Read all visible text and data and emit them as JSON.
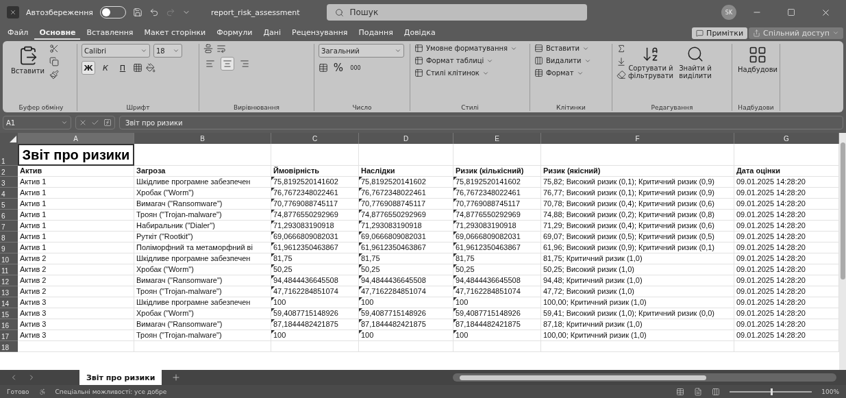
{
  "title_bar": {
    "autosave_label": "Автозбереження",
    "autosave_on": false,
    "file_name": "report_risk_assessment",
    "search": {
      "placeholder": "Пошук"
    },
    "avatar": "SK"
  },
  "menu_tabs": [
    {
      "label": "Файл",
      "selected": false
    },
    {
      "label": "Основне",
      "selected": true
    },
    {
      "label": "Вставлення",
      "selected": false
    },
    {
      "label": "Макет сторінки",
      "selected": false
    },
    {
      "label": "Формули",
      "selected": false
    },
    {
      "label": "Дані",
      "selected": false
    },
    {
      "label": "Рецензування",
      "selected": false
    },
    {
      "label": "Подання",
      "selected": false
    },
    {
      "label": "Довідка",
      "selected": false
    }
  ],
  "header_buttons": {
    "comments": "Примітки",
    "share": "Спільний доступ"
  },
  "ribbon": {
    "paste": "Вставити",
    "font_name": "Calibri",
    "font_size": "18",
    "font_styles": [
      {
        "label": "Ж",
        "selected": true
      },
      {
        "label": "К",
        "selected": false
      },
      {
        "label": "П",
        "selected": false
      }
    ],
    "alignment": [
      {
        "kind": "left",
        "selected": false
      },
      {
        "kind": "center",
        "selected": true
      },
      {
        "kind": "right",
        "selected": false
      }
    ],
    "number_format": "Загальний",
    "percent": "%",
    "thousands": "000",
    "styles": [
      "Умовне форматування",
      "Формат таблиці",
      "Стилі клітинок"
    ],
    "cells": [
      "Вставити",
      "Видалити",
      "Формат"
    ],
    "sort": "Сортувати й фільтрувати",
    "find": "Знайти й виділити",
    "addins": "Надбудови",
    "groups": [
      "Буфер обміну",
      "Шрифт",
      "Вирівнювання",
      "Число",
      "Стилі",
      "Клітинки",
      "Редагування",
      "Надбудови"
    ]
  },
  "formula_bar": {
    "name_box": "A1",
    "formula": "Звіт про ризики"
  },
  "sheet": {
    "columns": [
      {
        "letter": "A",
        "selected": true,
        "number_as_text": false
      },
      {
        "letter": "B",
        "selected": false,
        "number_as_text": false
      },
      {
        "letter": "C",
        "selected": false,
        "number_as_text": true
      },
      {
        "letter": "D",
        "selected": false,
        "number_as_text": true
      },
      {
        "letter": "E",
        "selected": false,
        "number_as_text": true
      },
      {
        "letter": "F",
        "selected": false,
        "number_as_text": false
      },
      {
        "letter": "G",
        "selected": false,
        "number_as_text": false
      }
    ],
    "title": "Звіт про ризики",
    "headers": [
      "Актив",
      "Загроза",
      "Ймовірність",
      "Наслідки",
      "Ризик (кількісний)",
      "Ризик (якісний)",
      "Дата оцінки"
    ],
    "rows": [
      [
        "Актив 1",
        "Шкідливе програмне забезпечен",
        "75,8192520141602",
        "75,8192520141602",
        "75,8192520141602",
        "75,82; Високий ризик (0,1); Критичний ризик (0,9)",
        "09.01.2025 14:28:20"
      ],
      [
        "Актив 1",
        "Хробак (\"Worm\")",
        "76,7672348022461",
        "76,7672348022461",
        "76,7672348022461",
        "76,77; Високий ризик (0,1); Критичний ризик (0,9)",
        "09.01.2025 14:28:20"
      ],
      [
        "Актив 1",
        "Вимагач (\"Ransomware\")",
        "70,7769088745117",
        "70,7769088745117",
        "70,7769088745117",
        "70,78; Високий ризик (0,4); Критичний ризик (0,6)",
        "09.01.2025 14:28:20"
      ],
      [
        "Актив 1",
        "Троян (\"Trojan-malware\")",
        "74,8776550292969",
        "74,8776550292969",
        "74,8776550292969",
        "74,88; Високий ризик (0,2); Критичний ризик (0,8)",
        "09.01.2025 14:28:20"
      ],
      [
        "Актив 1",
        "Набиральник (\"Dialer\")",
        "71,293083190918",
        "71,293083190918",
        "71,293083190918",
        "71,29; Високий ризик (0,4); Критичний ризик (0,6)",
        "09.01.2025 14:28:20"
      ],
      [
        "Актив 1",
        "Руткіт (\"Rootkit\")",
        "69,0666809082031",
        "69,0666809082031",
        "69,0666809082031",
        "69,07; Високий ризик (0,5); Критичний ризик (0,5)",
        "09.01.2025 14:28:20"
      ],
      [
        "Актив 1",
        "Поліморфний та метаморфний ві",
        "61,9612350463867",
        "61,9612350463867",
        "61,9612350463867",
        "61,96; Високий ризик (0,9); Критичний ризик (0,1)",
        "09.01.2025 14:28:20"
      ],
      [
        "Актив 2",
        "Шкідливе програмне забезпечен",
        "81,75",
        "81,75",
        "81,75",
        "81,75; Критичний ризик (1,0)",
        "09.01.2025 14:28:20"
      ],
      [
        "Актив 2",
        "Хробак (\"Worm\")",
        "50,25",
        "50,25",
        "50,25",
        "50,25; Високий ризик (1,0)",
        "09.01.2025 14:28:20"
      ],
      [
        "Актив 2",
        "Вимагач (\"Ransomware\")",
        "94,4844436645508",
        "94,4844436645508",
        "94,4844436645508",
        "94,48; Критичний ризик (1,0)",
        "09.01.2025 14:28:20"
      ],
      [
        "Актив 2",
        "Троян (\"Trojan-malware\")",
        "47,7162284851074",
        "47,7162284851074",
        "47,7162284851074",
        "47,72; Високий ризик (1,0)",
        "09.01.2025 14:28:20"
      ],
      [
        "Актив 3",
        "Шкідливе програмне забезпечен",
        "100",
        "100",
        "100",
        "100,00; Критичний ризик (1,0)",
        "09.01.2025 14:28:20"
      ],
      [
        "Актив 3",
        "Хробак (\"Worm\")",
        "59,4087715148926",
        "59,4087715148926",
        "59,4087715148926",
        "59,41; Високий ризик (1,0); Критичний ризик (0,0)",
        "09.01.2025 14:28:20"
      ],
      [
        "Актив 3",
        "Вимагач (\"Ransomware\")",
        "87,1844482421875",
        "87,1844482421875",
        "87,1844482421875",
        "87,18; Критичний ризик (1,0)",
        "09.01.2025 14:28:20"
      ],
      [
        "Актив 3",
        "Троян (\"Trojan-malware\")",
        "100",
        "100",
        "100",
        "100,00; Критичний ризик (1,0)",
        "09.01.2025 14:28:20"
      ]
    ],
    "row_numbers": [
      "1",
      "2",
      "3",
      "4",
      "5",
      "6",
      "7",
      "8",
      "9",
      "10",
      "11",
      "12",
      "13",
      "14",
      "15",
      "16",
      "17",
      "18"
    ]
  },
  "sheet_tabs": [
    {
      "label": "Звіт про ризики",
      "selected": true
    }
  ],
  "status_bar": {
    "ready": "Готово",
    "accessibility": "Спеціальні можливості: усе добре",
    "zoom": "100%",
    "zoom_slider": {
      "level": 0.5
    }
  }
}
